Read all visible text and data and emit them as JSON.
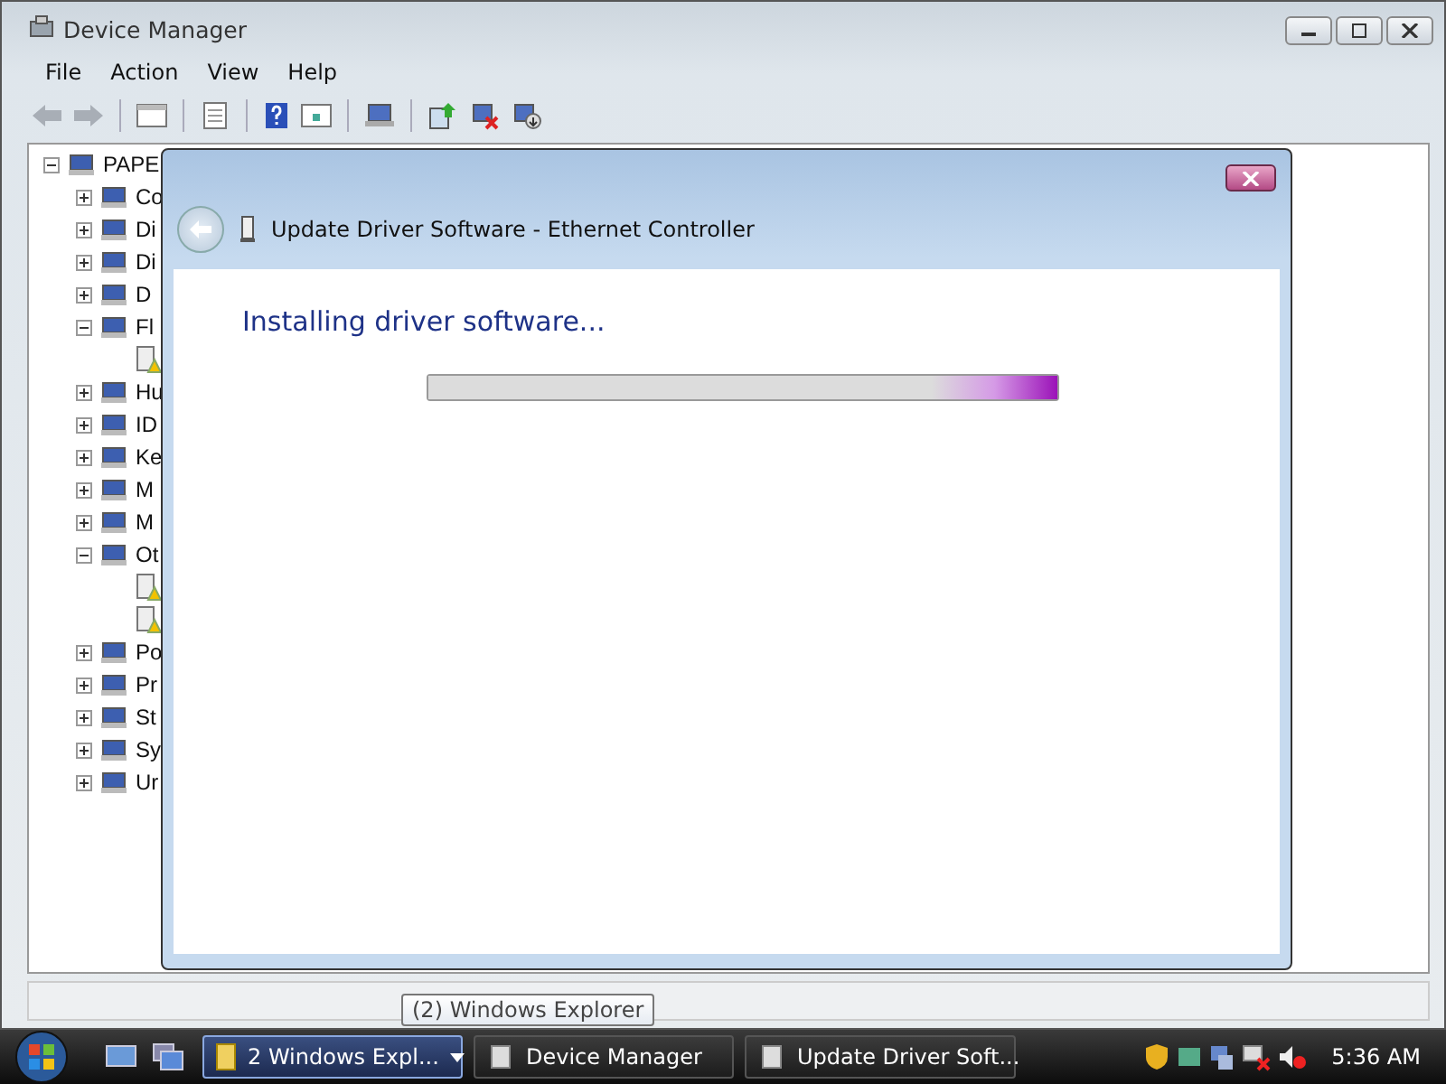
{
  "window": {
    "title": "Device Manager",
    "menu": [
      "File",
      "Action",
      "View",
      "Help"
    ]
  },
  "tree": {
    "label": "PAPE",
    "expanded": true,
    "children": [
      {
        "label": "Co",
        "expanded": false
      },
      {
        "label": "Di",
        "expanded": false
      },
      {
        "label": "Di",
        "expanded": false
      },
      {
        "label": "D",
        "expanded": false
      },
      {
        "label": "Fl",
        "expanded": true,
        "children": [
          {
            "warning": true
          }
        ]
      },
      {
        "label": "Hu",
        "expanded": false
      },
      {
        "label": "ID",
        "expanded": false
      },
      {
        "label": "Ke",
        "expanded": false
      },
      {
        "label": "M",
        "expanded": false
      },
      {
        "label": "M",
        "expanded": false
      },
      {
        "label": "Ot",
        "expanded": true,
        "children": [
          {
            "warning": true
          },
          {
            "warning": true
          }
        ]
      },
      {
        "label": "Po",
        "expanded": false
      },
      {
        "label": "Pr",
        "expanded": false
      },
      {
        "label": "St",
        "expanded": false
      },
      {
        "label": "Sy",
        "expanded": false
      },
      {
        "label": "Ur",
        "expanded": false
      }
    ]
  },
  "dialog": {
    "title": "Update Driver Software - Ethernet Controller",
    "heading": "Installing driver software...",
    "level": 1
  },
  "tooltip": "(2) Windows Explorer",
  "taskbar": {
    "buttons": [
      {
        "label": "2 Windows Expl...",
        "selected": true,
        "kind": "group"
      },
      {
        "label": "Device Manager",
        "selected": false,
        "kind": "window"
      },
      {
        "label": "Update Driver Soft...",
        "selected": false,
        "kind": "window"
      }
    ],
    "clock": "5:36 AM"
  }
}
